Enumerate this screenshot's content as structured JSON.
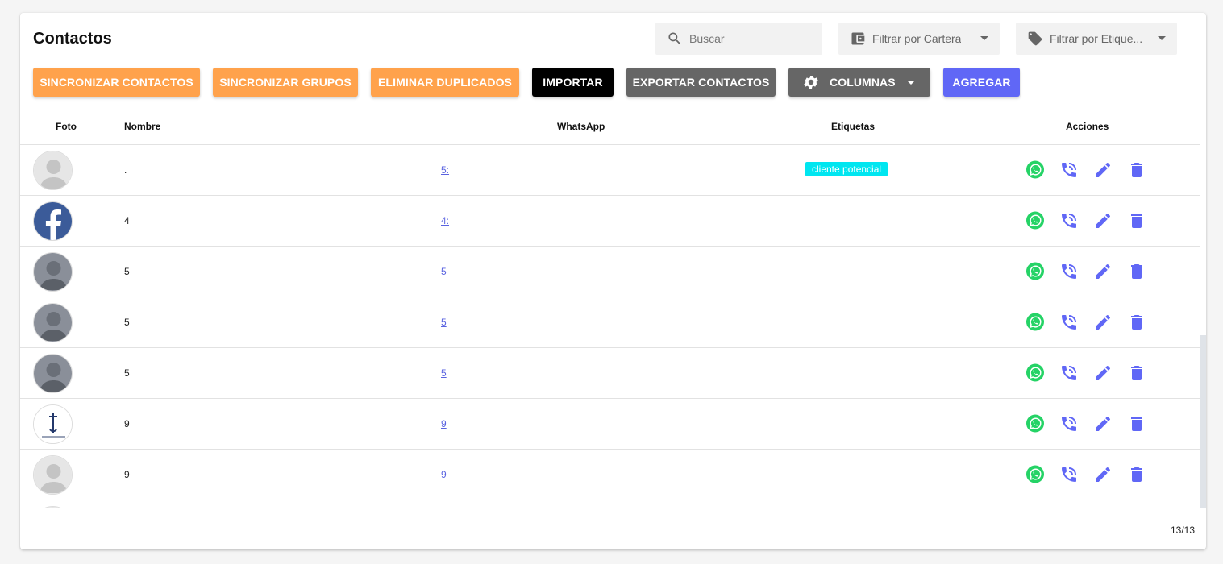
{
  "title": "Contactos",
  "search": {
    "placeholder": "Buscar",
    "icon": "search-icon"
  },
  "filters": [
    {
      "label": "Filtrar por Cartera",
      "icon": "wallet-icon"
    },
    {
      "label": "Filtrar por Etique...",
      "icon": "tag-icon"
    }
  ],
  "toolbar": {
    "sync_contacts": "SINCRONIZAR CONTACTOS",
    "sync_groups": "SINCRONIZAR GRUPOS",
    "remove_duplicates": "ELIMINAR DUPLICADOS",
    "import": "IMPORTAR",
    "export": "EXPORTAR CONTACTOS",
    "columns": "COLUMNAS",
    "add": "AGREGAR"
  },
  "colors": {
    "orange": "#ffa24c",
    "blue": "#6067f6",
    "gray": "#666666",
    "whatsapp": "#25d366",
    "tag": "#00e6f0",
    "link": "#5a63e0"
  },
  "table": {
    "headers": {
      "photo": "Foto",
      "name": "Nombre",
      "whatsapp": "WhatsApp",
      "tags": "Etiquetas",
      "actions": "Acciones"
    },
    "rows": [
      {
        "avatar": "default-avatar",
        "name": ".",
        "whatsapp": "5:",
        "tag": "cliente potencial"
      },
      {
        "avatar": "facebook-avatar",
        "name": "4",
        "whatsapp": "4:",
        "tag": ""
      },
      {
        "avatar": "photo-avatar",
        "name": "5",
        "whatsapp": "5",
        "tag": ""
      },
      {
        "avatar": "photo-avatar",
        "name": "5",
        "whatsapp": "5",
        "tag": ""
      },
      {
        "avatar": "photo-avatar",
        "name": "5",
        "whatsapp": "5",
        "tag": ""
      },
      {
        "avatar": "logo-avatar",
        "name": "9",
        "whatsapp": "9",
        "tag": ""
      },
      {
        "avatar": "default-avatar",
        "name": "9",
        "whatsapp": "9",
        "tag": ""
      }
    ]
  },
  "footer": {
    "count": "13/13"
  }
}
